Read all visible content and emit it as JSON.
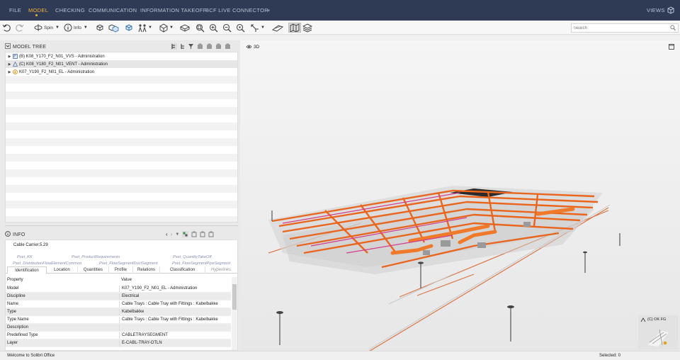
{
  "menu": {
    "items": [
      {
        "label": "FILE",
        "active": false
      },
      {
        "label": "MODEL",
        "active": true
      },
      {
        "label": "CHECKING",
        "active": false
      },
      {
        "label": "COMMUNICATION",
        "active": false
      },
      {
        "label": "INFORMATION TAKEOFF",
        "active": false
      },
      {
        "label": "BCF LIVE CONNECTOR",
        "active": false
      },
      {
        "label": "+",
        "active": false
      }
    ],
    "views_label": "VIEWS",
    "accent_color": "#f6b13a",
    "bar_color": "#2f3a55"
  },
  "toolbar": {
    "spin_label": "Spin",
    "info_label": "Info",
    "search_placeholder": "Search",
    "icons": [
      "undo-icon",
      "redo-icon",
      "spin-icon",
      "info-icon",
      "select-icon",
      "visibility-icon",
      "cube-icon",
      "walk-icon",
      "section-icon",
      "bounding-box-icon",
      "zoom-fit-icon",
      "zoom-in-icon",
      "zoom-out-icon",
      "zoom-window-icon",
      "measure-icon",
      "slice-icon",
      "map-icon",
      "layers-icon"
    ]
  },
  "model_tree": {
    "title": "MODEL TREE",
    "items": [
      {
        "label": "(B) K08_Y170_F2_N01_VVS - Administration",
        "icon": "plumbing-model-icon"
      },
      {
        "label": "(C) K08_Y180_F2_N01_VENT - Administration",
        "icon": "ventilation-model-icon"
      },
      {
        "label": "K07_Y190_F2_N01_EL - Administration",
        "icon": "electrical-model-icon"
      }
    ]
  },
  "info": {
    "title": "INFO",
    "object_title": "Cable Carrier.5.29",
    "tabs_row1": [
      "Pset_KK",
      "Pset_ProductRequirements",
      "Pset_QuantityTakeOff"
    ],
    "tabs_row2": [
      "Pset_DistributionFlowElementCommon",
      "Pset_FlowSegmentDuctSegment",
      "Pset_FlowSegmentPipeSegment"
    ],
    "tabs_row3": [
      "Identification",
      "Location",
      "Quantities",
      "Profile",
      "Relations",
      "Classification",
      "Hyperlinks"
    ],
    "active_tab": "Identification",
    "columns": [
      "Property",
      "Value"
    ],
    "rows": [
      {
        "property": "Model",
        "value": "K07_Y190_F2_N01_EL - Administration"
      },
      {
        "property": "Discipline",
        "value": "Electrical"
      },
      {
        "property": "Name",
        "value": "Cable Trays : Cable Tray with Fittings : Kabelbakke"
      },
      {
        "property": "Type",
        "value": "Kabelbakke"
      },
      {
        "property": "Type Name",
        "value": "Cable Trays : Cable Tray with Fittings : Kabelbakke"
      },
      {
        "property": "Description",
        "value": ""
      },
      {
        "property": "Predefined Type",
        "value": "CABLETRAYSEGMENT"
      },
      {
        "property": "Layer",
        "value": "E-CABL-TRAY-OTLN"
      }
    ]
  },
  "viewport": {
    "label": "3D",
    "cube_label": "(C) OK FG",
    "model_color": "#e8661e"
  },
  "status": {
    "left": "Welcome to Solibri Office",
    "right": "Selected: 0"
  }
}
